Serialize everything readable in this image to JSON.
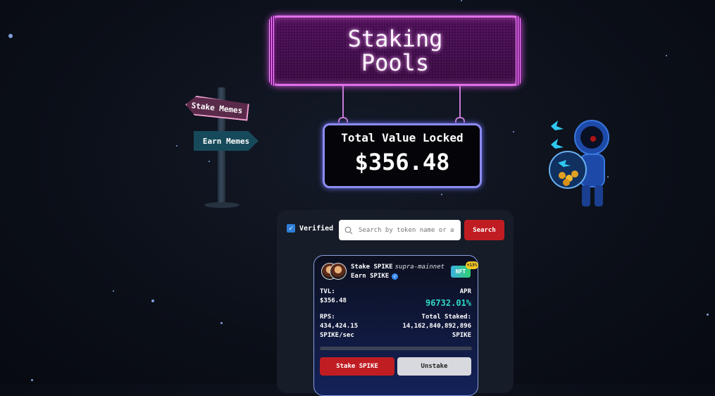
{
  "title": {
    "text": "Staking\nPools"
  },
  "tvl": {
    "label": "Total Value Locked",
    "value": "$356.48"
  },
  "signpost": {
    "left_arrow_label": "Stake Memes",
    "right_arrow_label": "Earn Memes"
  },
  "filters": {
    "verified_label": "Verified",
    "verified_checked": true,
    "search_placeholder": "Search by token name or address",
    "search_button": "Search"
  },
  "pool_card": {
    "stake_title": "Stake SPIKE",
    "network": "supra-mainnet",
    "earn_title": "Earn SPIKE",
    "nft_label": "NFT",
    "nft_bonus": "+13%",
    "tvl_label": "TVL:",
    "tvl_value": "$356.48",
    "apr_label": "APR",
    "apr_value": "96732.01%",
    "rps_label": "RPS:",
    "rps_value": "434,424.15",
    "rps_unit": "SPIKE/sec",
    "total_staked_label": "Total Staked:",
    "total_staked_value": "14,162,840,892,896",
    "total_staked_unit": "SPIKE",
    "progress": 0,
    "stake_button": "Stake SPIKE",
    "unstake_button": "Unstake"
  },
  "colors": {
    "accent_red": "#c01d22",
    "apr_teal": "#2fd8c8",
    "title_neon": "#e070e8",
    "tvl_neon": "#8b8cf0"
  }
}
